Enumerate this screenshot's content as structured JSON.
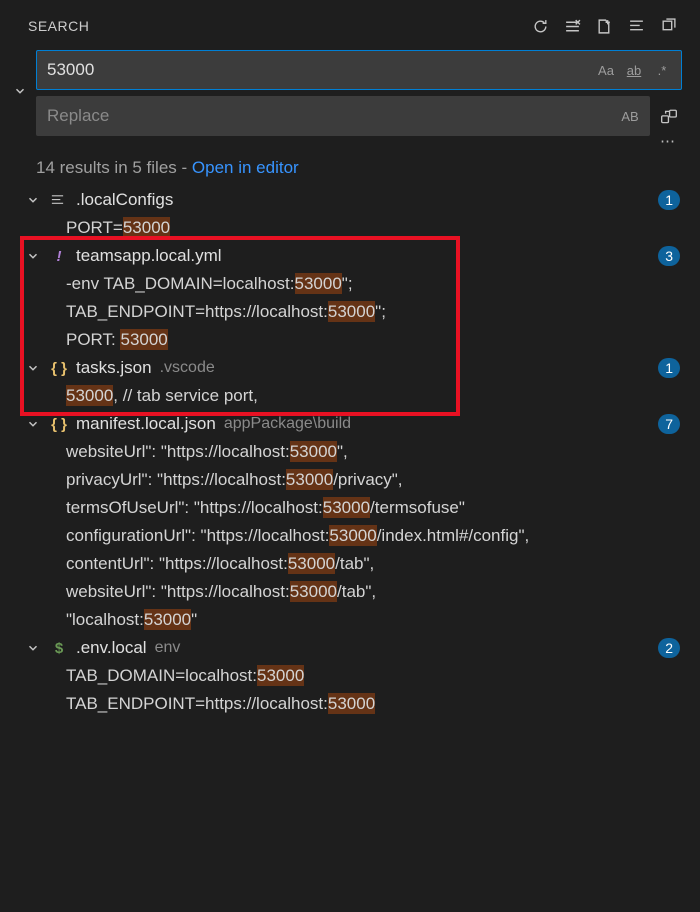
{
  "header": {
    "title": "SEARCH"
  },
  "search": {
    "value": "53000",
    "replace_placeholder": "Replace"
  },
  "summary": {
    "results_text": "14 results in 5 files - ",
    "open_link": "Open in editor"
  },
  "files": [
    {
      "name": ".localConfigs",
      "folder": "",
      "icon": "lines",
      "count": "1",
      "lines": [
        {
          "pre": "PORT=",
          "match": "53000",
          "post": ""
        }
      ]
    },
    {
      "name": "teamsapp.local.yml",
      "folder": "",
      "icon": "bang",
      "count": "3",
      "lines": [
        {
          "pre": "-env TAB_DOMAIN=localhost:",
          "match": "53000",
          "post": "\";"
        },
        {
          "pre": "TAB_ENDPOINT=https://localhost:",
          "match": "53000",
          "post": "\";"
        },
        {
          "pre": "PORT: ",
          "match": "53000",
          "post": ""
        }
      ]
    },
    {
      "name": "tasks.json",
      "folder": ".vscode",
      "icon": "braces",
      "count": "1",
      "lines": [
        {
          "pre": "",
          "match": "53000",
          "post": ", // tab service port,"
        }
      ]
    },
    {
      "name": "manifest.local.json",
      "folder": "appPackage\\build",
      "icon": "braces",
      "count": "7",
      "lines": [
        {
          "pre": "websiteUrl\": \"https://localhost:",
          "match": "53000",
          "post": "\","
        },
        {
          "pre": "privacyUrl\": \"https://localhost:",
          "match": "53000",
          "post": "/privacy\","
        },
        {
          "pre": "termsOfUseUrl\": \"https://localhost:",
          "match": "53000",
          "post": "/termsofuse\""
        },
        {
          "pre": "configurationUrl\": \"https://localhost:",
          "match": "53000",
          "post": "/index.html#/config\","
        },
        {
          "pre": "contentUrl\": \"https://localhost:",
          "match": "53000",
          "post": "/tab\","
        },
        {
          "pre": "websiteUrl\": \"https://localhost:",
          "match": "53000",
          "post": "/tab\","
        },
        {
          "pre": "\"localhost:",
          "match": "53000",
          "post": "\""
        }
      ]
    },
    {
      "name": ".env.local",
      "folder": "env",
      "icon": "dollar",
      "count": "2",
      "lines": [
        {
          "pre": "TAB_DOMAIN=localhost:",
          "match": "53000",
          "post": ""
        },
        {
          "pre": "TAB_ENDPOINT=https://localhost:",
          "match": "53000",
          "post": ""
        }
      ]
    }
  ]
}
